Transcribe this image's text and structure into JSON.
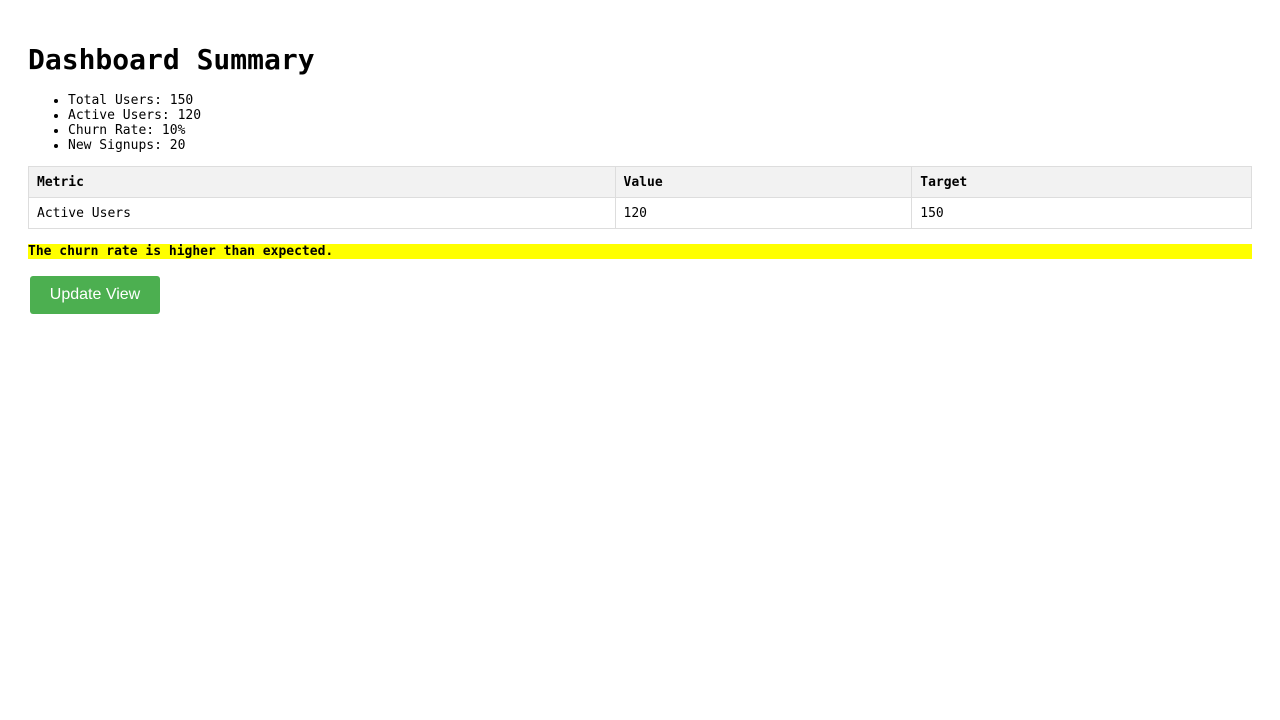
{
  "page": {
    "title": "Dashboard Summary"
  },
  "stats": {
    "items": [
      "Total Users: 150",
      "Active Users: 120",
      "Churn Rate: 10%",
      "New Signups: 20"
    ]
  },
  "table": {
    "headers": [
      "Metric",
      "Value",
      "Target"
    ],
    "rows": [
      [
        "Active Users",
        "120",
        "150"
      ]
    ]
  },
  "alert": {
    "text": "The churn rate is higher than expected.",
    "color": "#ffff00"
  },
  "actions": {
    "update_label": "Update View",
    "button_color": "#4caf50"
  }
}
